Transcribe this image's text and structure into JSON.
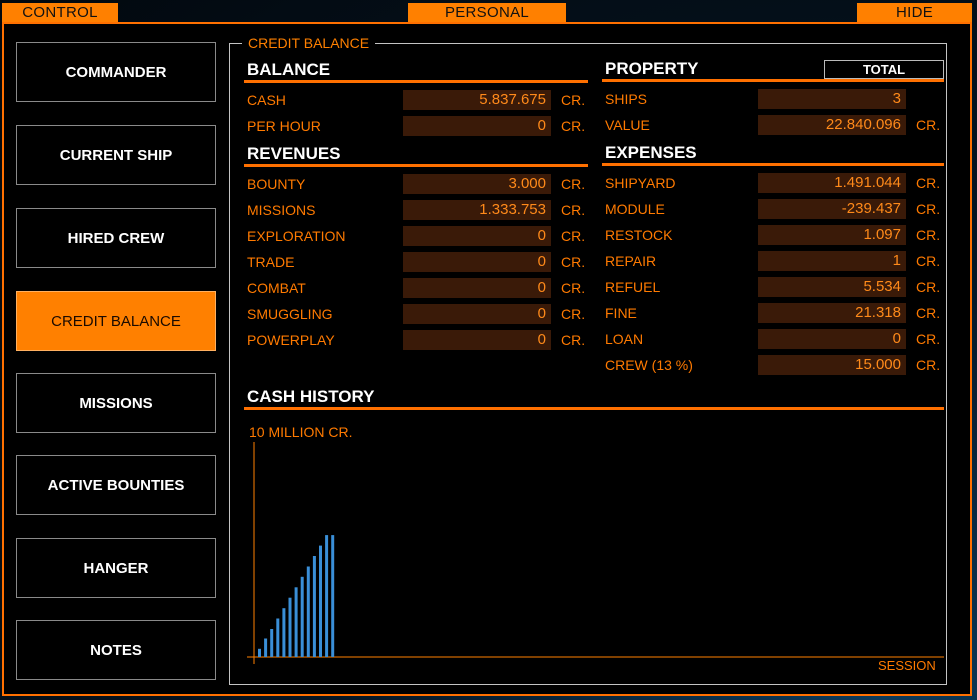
{
  "top_bar": {
    "control": "CONTROL",
    "personal": "PERSONAL",
    "hide": "HIDE"
  },
  "nav": [
    "COMMANDER",
    "CURRENT SHIP",
    "HIRED CREW",
    "CREDIT BALANCE",
    "MISSIONS",
    "ACTIVE BOUNTIES",
    "HANGER",
    "NOTES"
  ],
  "nav_active": "CREDIT BALANCE",
  "panel": {
    "title": "CREDIT BALANCE"
  },
  "balance": {
    "heading": "BALANCE",
    "rows": [
      {
        "label": "CASH",
        "value": "5.837.675",
        "unit": "CR."
      },
      {
        "label": "PER HOUR",
        "value": "0",
        "unit": "CR."
      }
    ]
  },
  "property": {
    "heading": "PROPERTY",
    "total_button": "TOTAL",
    "rows": [
      {
        "label": "SHIPS",
        "value": "3",
        "unit": ""
      },
      {
        "label": "VALUE",
        "value": "22.840.096",
        "unit": "CR."
      }
    ]
  },
  "revenues": {
    "heading": "REVENUES",
    "rows": [
      {
        "label": "BOUNTY",
        "value": "3.000",
        "unit": "CR."
      },
      {
        "label": "MISSIONS",
        "value": "1.333.753",
        "unit": "CR."
      },
      {
        "label": "EXPLORATION",
        "value": "0",
        "unit": "CR."
      },
      {
        "label": "TRADE",
        "value": "0",
        "unit": "CR."
      },
      {
        "label": "COMBAT",
        "value": "0",
        "unit": "CR."
      },
      {
        "label": "SMUGGLING",
        "value": "0",
        "unit": "CR."
      },
      {
        "label": "POWERPLAY",
        "value": "0",
        "unit": "CR."
      }
    ]
  },
  "expenses": {
    "heading": "EXPENSES",
    "rows": [
      {
        "label": "SHIPYARD",
        "value": "1.491.044",
        "unit": "CR."
      },
      {
        "label": "MODULE",
        "value": "-239.437",
        "unit": "CR."
      },
      {
        "label": "RESTOCK",
        "value": "1.097",
        "unit": "CR."
      },
      {
        "label": "REPAIR",
        "value": "1",
        "unit": "CR."
      },
      {
        "label": "REFUEL",
        "value": "5.534",
        "unit": "CR."
      },
      {
        "label": "FINE",
        "value": "21.318",
        "unit": "CR."
      },
      {
        "label": "LOAN",
        "value": "0",
        "unit": "CR."
      },
      {
        "label": "CREW (13 %)",
        "value": "15.000",
        "unit": "CR."
      }
    ]
  },
  "cash_history": {
    "heading": "CASH HISTORY",
    "y_label": "10 MILLION CR.",
    "x_label": "SESSION"
  },
  "colors": {
    "accent": "#ff8000",
    "bar": "#3a8fd8",
    "value_bg": "#3a1a08"
  },
  "chart_data": {
    "type": "bar",
    "ylabel": "10 MILLION CR.",
    "xlabel": "SESSION",
    "ylim": [
      0,
      10000000
    ],
    "values": [
      380000,
      860000,
      1300000,
      1790000,
      2270000,
      2760000,
      3240000,
      3730000,
      4210000,
      4700000,
      5180000,
      5670000,
      5670000
    ]
  }
}
